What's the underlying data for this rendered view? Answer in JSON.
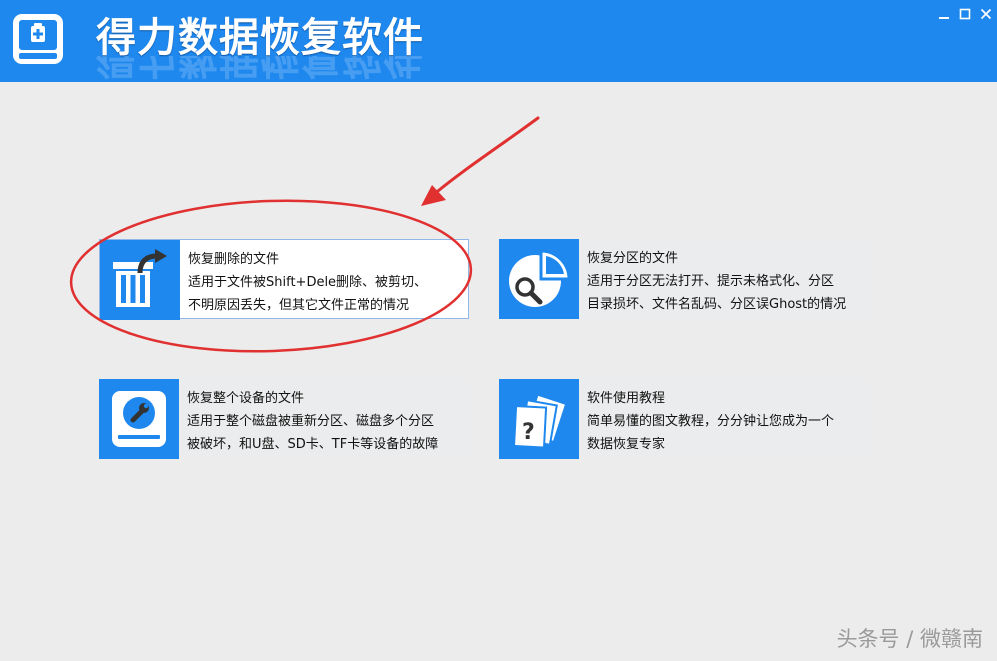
{
  "window": {
    "title": "得力数据恢复软件",
    "colors": {
      "titlebar": "#1e88ee",
      "background": "#ececec",
      "annotation": "#e03030"
    }
  },
  "window_controls": [
    "minimize-icon",
    "maximize-icon",
    "close-icon"
  ],
  "cards": [
    {
      "title": "恢复删除的文件",
      "line1": "适用于文件被Shift+Dele删除、被剪切、",
      "line2": "不明原因丢失，但其它文件正常的情况",
      "icon": "trash-restore-icon",
      "highlighted": true
    },
    {
      "title": "恢复分区的文件",
      "line1": "适用于分区无法打开、提示未格式化、分区",
      "line2": "目录损坏、文件名乱码、分区误Ghost的情况",
      "icon": "partition-search-icon"
    },
    {
      "title": "恢复整个设备的文件",
      "line1": "适用于整个磁盘被重新分区、磁盘多个分区",
      "line2": "被破坏，和U盘、SD卡、TF卡等设备的故障",
      "icon": "disk-repair-icon"
    },
    {
      "title": "软件使用教程",
      "line1": "简单易懂的图文教程，分分钟让您成为一个",
      "line2": "数据恢复专家",
      "icon": "help-document-icon"
    }
  ],
  "watermark": "头条号 / 微赣南"
}
